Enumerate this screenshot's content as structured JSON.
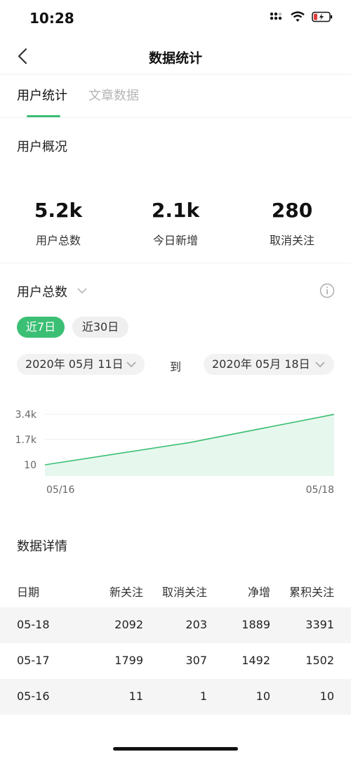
{
  "status": {
    "time": "10:28"
  },
  "nav": {
    "title": "数据统计"
  },
  "tabs": [
    {
      "label": "用户统计",
      "active": true
    },
    {
      "label": "文章数据",
      "active": false
    }
  ],
  "overview": {
    "title": "用户概况",
    "stats": [
      {
        "value": "5.2k",
        "label": "用户总数"
      },
      {
        "value": "2.1k",
        "label": "今日新增"
      },
      {
        "value": "280",
        "label": "取消关注"
      }
    ]
  },
  "chart_section": {
    "metric_label": "用户总数",
    "ranges": [
      "近7日",
      "近30日"
    ],
    "selected_range": "近7日",
    "from_date": "2020年 05月 11日",
    "to_label": "到",
    "to_date": "2020年 05月 18日"
  },
  "chart_data": {
    "type": "area",
    "x": [
      "05/16",
      "05/17",
      "05/18"
    ],
    "series": [
      {
        "values": [
          10,
          1502,
          3391
        ]
      }
    ],
    "y_ticks": [
      "3.4k",
      "1.7k",
      "10"
    ],
    "x_tick_labels": [
      "05/16",
      "05/18"
    ],
    "ylim": [
      10,
      3400
    ],
    "grid": true,
    "colors": {
      "line": "#3bbf74",
      "fill": "#e6f7ee"
    }
  },
  "details": {
    "title": "数据详情",
    "headers": [
      "日期",
      "新关注",
      "取消关注",
      "净增",
      "累积关注"
    ],
    "rows": [
      [
        "05-18",
        "2092",
        "203",
        "1889",
        "3391"
      ],
      [
        "05-17",
        "1799",
        "307",
        "1492",
        "1502"
      ],
      [
        "05-16",
        "11",
        "1",
        "10",
        "10"
      ]
    ]
  },
  "theme": {
    "accent": "#3bbf74"
  }
}
